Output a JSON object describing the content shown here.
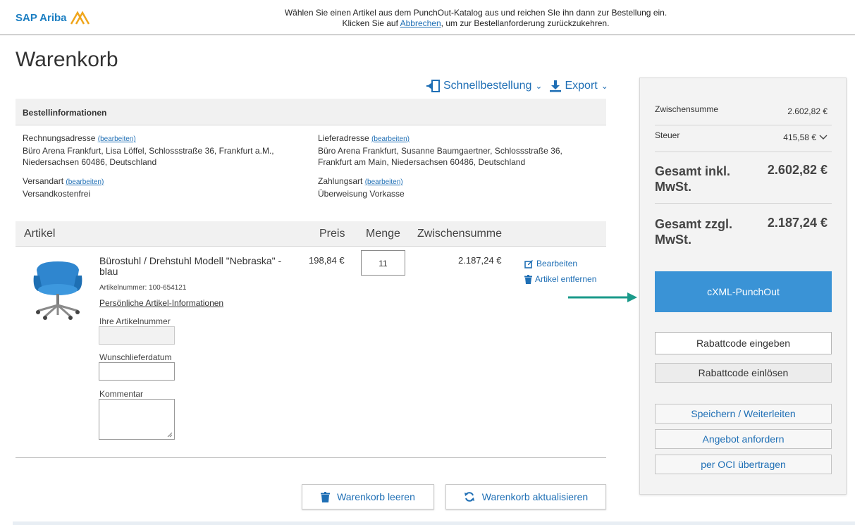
{
  "header": {
    "logo_text": "SAP Ariba",
    "notice_line1": "Wählen Sie einen Artikel aus dem PunchOut-Katalog aus und reichen SIe ihn dann zur Bestellung ein.",
    "notice_line2_prefix": "Klicken Sie auf ",
    "notice_link": "Abbrechen",
    "notice_line2_suffix": ", um zur Bestellanforderung zurückzukehren."
  },
  "page": {
    "title": "Warenkorb"
  },
  "tools": {
    "quick_order": "Schnellbestellung",
    "export": "Export"
  },
  "order_info": {
    "heading": "Bestellinformationen",
    "edit_label": "(bearbeiten)",
    "billing_label": "Rechnungsadresse",
    "billing_line1": "Büro Arena Frankfurt, Lisa Löffel, Schlossstraße 36, Frankfurt a.M.,",
    "billing_line2": "Niedersachsen 60486, Deutschland",
    "delivery_label": "Lieferadresse",
    "delivery_line1": "Büro Arena Frankfurt, Susanne Baumgaertner, Schlossstraße 36,",
    "delivery_line2": "Frankfurt am Main, Niedersachsen 60486, Deutschland",
    "shipping_label": "Versandart",
    "shipping_value": "Versandkostenfrei",
    "payment_label": "Zahlungsart",
    "payment_value": "Überweisung Vorkasse"
  },
  "articles": {
    "headers": {
      "article": "Artikel",
      "price": "Preis",
      "quantity": "Menge",
      "subtotal": "Zwischensumme"
    },
    "item": {
      "title_line1": "Bürostuhl / Drehstuhl Modell \"Nebraska\" -",
      "title_line2": "blau",
      "article_number": "Artikelnummer: 100-654121",
      "personal_info_link": "Persönliche Artikel-Informationen",
      "your_article_number_label": "Ihre Artikelnummer",
      "delivery_date_label": "Wunschlieferdatum",
      "comment_label": "Kommentar",
      "price": "198,84 €",
      "quantity": "11",
      "subtotal": "2.187,24 €",
      "edit_action": "Bearbeiten",
      "remove_action": "Artikel entfernen"
    }
  },
  "bottom_buttons": {
    "empty_cart": "Warenkorb leeren",
    "update_cart": "Warenkorb aktualisieren"
  },
  "summary": {
    "subtotal_label": "Zwischensumme",
    "subtotal_value": "2.602,82 €",
    "tax_label": "Steuer",
    "tax_value": "415,58 €",
    "total_incl_label_line1": "Gesamt inkl.",
    "total_incl_label_line2": "MwSt.",
    "total_incl_value": "2.602,82 €",
    "total_excl_label_line1": "Gesamt zzgl.",
    "total_excl_label_line2": "MwSt.",
    "total_excl_value": "2.187,24 €",
    "punchout_button": "cXML-PunchOut",
    "coupon_enter_button": "Rabattcode eingeben",
    "coupon_redeem_button": "Rabattcode einlösen",
    "save_forward_button": "Speichern / Weiterleiten",
    "request_quote_button": "Angebot anfordern",
    "oci_button": "per OCI übertragen"
  },
  "colors": {
    "accent": "#1f6fb5",
    "primary_button": "#3a93d6",
    "arrow": "#1a9a8a"
  }
}
